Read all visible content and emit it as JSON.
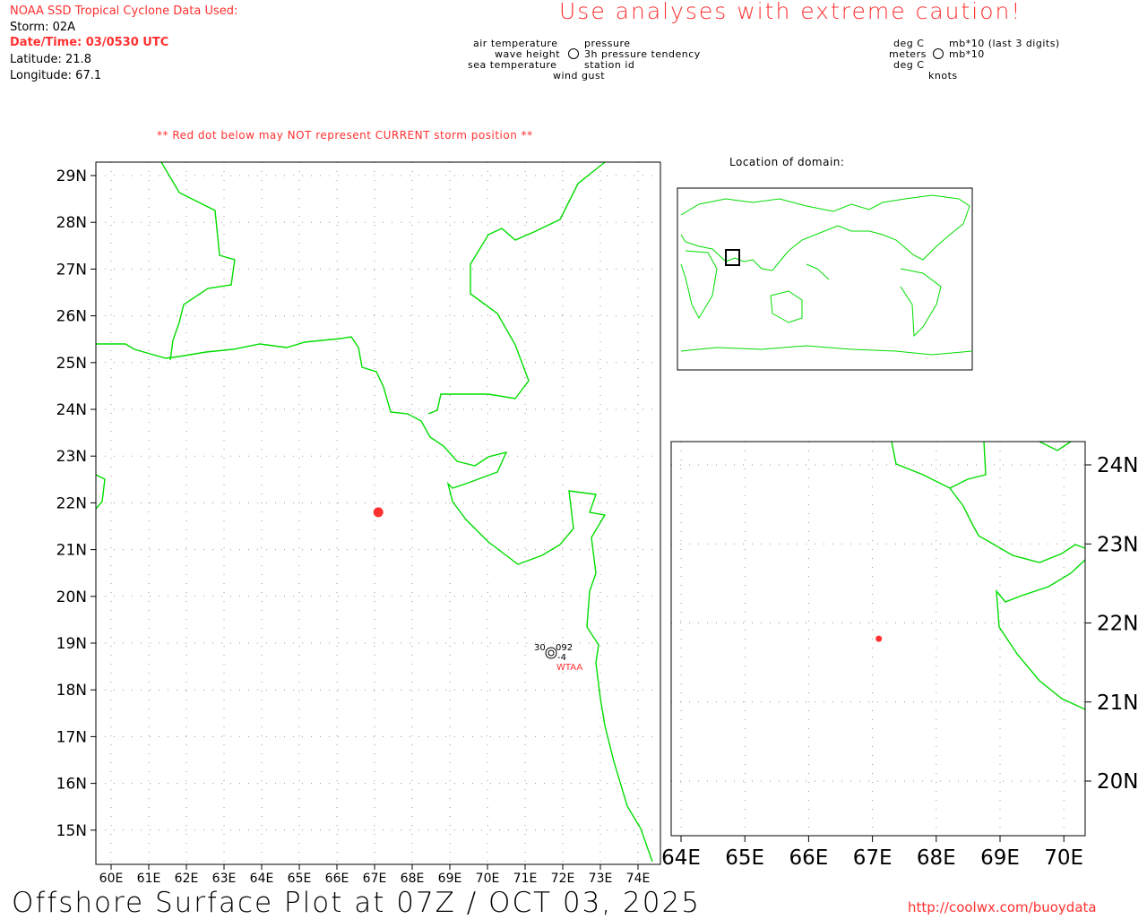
{
  "header": {
    "source": "NOAA SSD Tropical Cyclone Data Used:",
    "storm": "Storm: 02A",
    "datetime": "Date/Time: 03/0530 UTC",
    "latitude": "Latitude: 21.8",
    "longitude": "Longitude: 67.1",
    "caution": "Use analyses with extreme caution!"
  },
  "legend": {
    "air_temperature": "air temperature",
    "wave_height": "wave height",
    "sea_temperature": "sea temperature",
    "pressure": "pressure",
    "pressure_tendency": "3h pressure tendency",
    "station_id": "station id",
    "wind_gust": "wind gust",
    "unit_deg_c_1": "deg C",
    "unit_meters": "meters",
    "unit_deg_c_2": "deg C",
    "unit_mb_last3": "mb*10 (last 3 digits)",
    "unit_mb": "mb*10",
    "unit_knots": "knots"
  },
  "warning": "** Red dot below may NOT represent CURRENT storm position **",
  "location_title": "Location of domain:",
  "main_map": {
    "lon_ticks": [
      "60E",
      "61E",
      "62E",
      "63E",
      "64E",
      "65E",
      "66E",
      "67E",
      "68E",
      "69E",
      "70E",
      "71E",
      "72E",
      "73E",
      "74E"
    ],
    "lat_ticks": [
      "29N",
      "28N",
      "27N",
      "26N",
      "25N",
      "24N",
      "23N",
      "22N",
      "21N",
      "20N",
      "19N",
      "18N",
      "17N",
      "16N",
      "15N"
    ],
    "storm_position": {
      "lat": 21.8,
      "lon": 67.1
    }
  },
  "station": {
    "id": "WTAA",
    "air_temp": "30",
    "pressure": "092",
    "tendency": "-4",
    "lat": 18.9,
    "lon": 71.7
  },
  "inset_map": {
    "lon_ticks": [
      "64E",
      "65E",
      "66E",
      "67E",
      "68E",
      "69E",
      "70E"
    ],
    "lat_ticks": [
      "24N",
      "23N",
      "22N",
      "21N",
      "20N"
    ]
  },
  "colors": {
    "coast": "#00dd00",
    "storm": "#ff3030",
    "text_red": "#ff3030"
  },
  "footer": {
    "title": "Offshore Surface Plot at 07Z / OCT 03, 2025",
    "url": "http://coolwx.com/buoydata"
  }
}
